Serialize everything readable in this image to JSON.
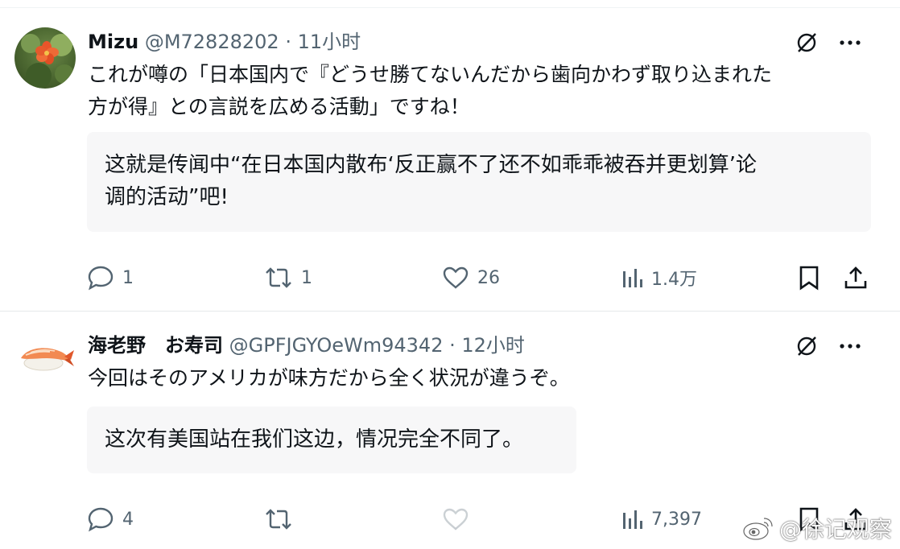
{
  "tweets": [
    {
      "name": "Mizu",
      "handle": "@M72828202",
      "sep": "·",
      "time": "11小时",
      "text_lines": [
        "これが噂の「日本国内で『どうせ勝てないんだから歯向かわず取り込まれた",
        "方が得』との言説を広める活動」ですね！"
      ],
      "translation_lines": [
        "这就是传闻中“在日本国内散布‘反正赢不了还不如乖乖被吞并更划算’论",
        "调的活动”吧!"
      ],
      "replies": "1",
      "retweets": "1",
      "likes": "26",
      "views": "1.4万",
      "avatar_icon": "flower-avatar-icon"
    },
    {
      "name": "海老野　お寿司",
      "handle": "@GPFJGYOeWm94342",
      "sep": "·",
      "time": "12小时",
      "text_lines": [
        "今回はそのアメリカが味方だから全く状況が違うぞ。"
      ],
      "translation_lines": [
        "这次有美国站在我们这边，情况完全不同了。"
      ],
      "replies": "4",
      "retweets": "",
      "likes": "",
      "views": "7,397",
      "avatar_icon": "shrimp-sushi-avatar-icon"
    }
  ],
  "watermark": "@徐记观察",
  "colors": {
    "text": "#0f1419",
    "muted": "#536471",
    "translation_bg": "#f7f7f8",
    "flower": "#e8542a"
  }
}
